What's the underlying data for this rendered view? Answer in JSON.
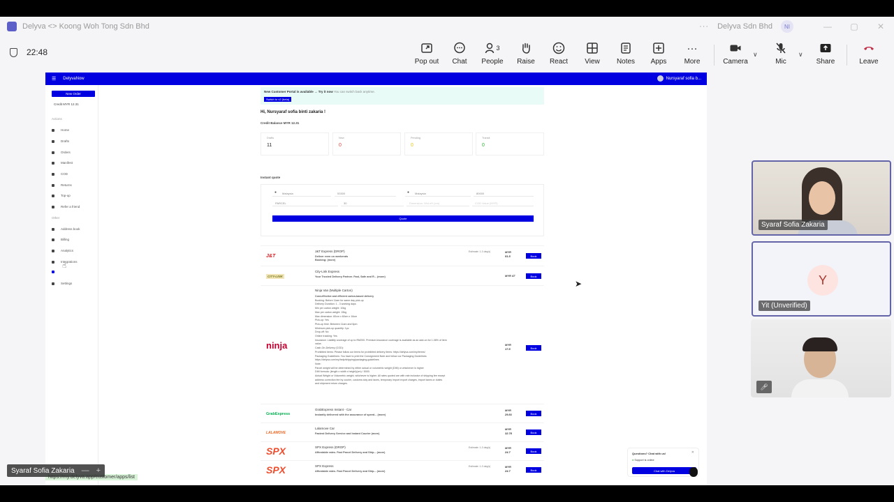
{
  "window": {
    "title": "Delyva <> Koong Woh Tong Sdn Bhd",
    "org": "Delyva Sdn Bhd",
    "initials": "NI"
  },
  "meeting": {
    "timer": "22:48",
    "people_count": "3",
    "buttons": {
      "popout": "Pop out",
      "chat": "Chat",
      "people": "People",
      "raise": "Raise",
      "react": "React",
      "view": "View",
      "notes": "Notes",
      "apps": "Apps",
      "more": "More",
      "camera": "Camera",
      "mic": "Mic",
      "share": "Share",
      "leave": "Leave"
    }
  },
  "participants": [
    {
      "name": "Syaraf Sofia Zakaria"
    },
    {
      "name": "Yit (Unverified)",
      "initial": "Y"
    },
    {
      "name": ""
    }
  ],
  "presenter": {
    "name": "Syaraf Sofia Zakaria",
    "minimize": "—",
    "add": "+"
  },
  "delyva": {
    "brand": "DelyvaNow",
    "user": "Nursyaraf sofia b...",
    "new_order": "New Order",
    "credit": "Credit MYR 12.31",
    "sections": {
      "actions": "Actions",
      "other": "Other"
    },
    "nav": [
      "Home",
      "Drafts",
      "Orders",
      "Manifest",
      "COD",
      "Returns",
      "Top-up",
      "Refer a friend"
    ],
    "nav_other": [
      "Address book",
      "Billing",
      "Analytics",
      "Integrations",
      "",
      "Settings"
    ],
    "banner_text": "New Customer Portal is available → Try it now",
    "banner_sub": "You can switch back anytime.",
    "banner_button": "Switch to v2 (beta)",
    "greeting": "Hi, Nursyaraf sofia binti zakaria !",
    "credit_balance": "Credit Balance MYR 12.31",
    "stats": [
      {
        "label": "Drafts",
        "value": "11",
        "color": "#222222"
      },
      {
        "label": "New",
        "value": "0",
        "color": "#e53935"
      },
      {
        "label": "Pending",
        "value": "0",
        "color": "#f0c419"
      },
      {
        "label": "Transit",
        "value": "0",
        "color": "#2eb82e"
      }
    ],
    "instant_quote": "Instant quote",
    "quote_fields": {
      "from_country": "Malaysia",
      "from_postcode": "53300",
      "to_country": "Malaysia",
      "to_postcode": "80000",
      "type": "PARCEL",
      "weight": "30",
      "dimension_placeholder": "Dimension: WxLxH (cm)",
      "cod_placeholder": "COD Value (MYR)"
    },
    "quote_button": "Quote",
    "carriers": [
      {
        "logo": "J&T",
        "name": "J&T Express (DROP)",
        "desc": "Deliver even on weekends",
        "desc2": "Booking: (more)",
        "est": "Estimate: 1-3 day(s)",
        "currency": "MYR",
        "price": "51.5",
        "book": "Book"
      },
      {
        "logo": "CITY-LINK",
        "name": "City-Link Express",
        "desc": "Your Trusted Delivery Partner. Fast, Safe and R... (more)",
        "currency": "MYR",
        "price": "47",
        "book": "Book"
      },
      {
        "logo": "ninja",
        "name": "Ninja Van (Multiple Carton)",
        "currency": "MYR",
        "price": "17.8",
        "book": "Book",
        "details": [
          "Cost-effective and efficient carton-based delivery",
          "Booking: Before 11am for same day pick-up",
          "Delivery Duration: 1 - 3 working days",
          "Min per carton weight: 10kg",
          "Max per carton weight: 15kg",
          "Max dimension: 60cm x 60cm x 16cm",
          "Pick-up: Yes",
          "Pick-up time: Between 11am and 6pm",
          "Minimum pick-up quantity: 1pc",
          "Drop-off: No",
          "Online tracking: Yes",
          "Insurance: Liability coverage of up to RM200. Premium insurance coverage is available as an add-on for 1.08% of item",
          "value.",
          "Cash-On-Delivery (COD):",
          "Prohibited items: Please follow our terms for prohibited delivery items: https://delyva.com/my/terms/",
          "Packaging Guidelines: You have to print the Consignment Note and follow our Packaging Guidelines:",
          "https://delyva.com/my/help/shipping/packaging-guidelines",
          "Note:",
          "Parcel weight will be determined by either actual or volumetric weight (DIM) or whichever is higher",
          "DIM formula: (length x width x height)(cm) / 5000.",
          "Actual Weight or Volumetric weight, whichever is higher. All rates quoted are with rate inclusive of shipping fee except",
          "address correction fee by courier, customs duty and taxes, temporary import export charges, import taxes or duties",
          "and shipment return charges."
        ]
      },
      {
        "logo": "GrabExpress",
        "name": "GrabExpress Instant - Car",
        "desc": "Instantly delivered with the assurance of speed... (more)",
        "currency": "MYR",
        "price": "29.81",
        "book": "Book"
      },
      {
        "logo": "LALAMOVE",
        "name": "Lalamove Car",
        "desc": "Fastest Delivery Service and Instant Courier (more)",
        "currency": "MYR",
        "price": "32.78",
        "book": "Book"
      },
      {
        "logo": "SPX",
        "name": "SPX Express (DROP)",
        "desc": "Affordable rates. Fast Parcel Delivery and Ship... (more)",
        "est": "Estimate: 1-3 day(s)",
        "currency": "MYR",
        "price": "24.7",
        "book": "Book"
      },
      {
        "logo": "SPX",
        "name": "SPX Express",
        "desc": "Affordable rates. Fast Parcel Delivery and Ship... (more)",
        "est": "Estimate: 1-3 day(s)",
        "currency": "MYR",
        "price": "24.7",
        "book": "Book"
      }
    ],
    "chat_widget": {
      "question": "Questions? Chat with us!",
      "support": "Support is online",
      "button": "Chat with Delyva"
    },
    "status_url": "https://my.delyva.app/customer/apps/list"
  },
  "colors": {
    "teams_purple": "#6264a7",
    "delyva_blue": "#0000e0",
    "leave_red": "#c4314b"
  }
}
